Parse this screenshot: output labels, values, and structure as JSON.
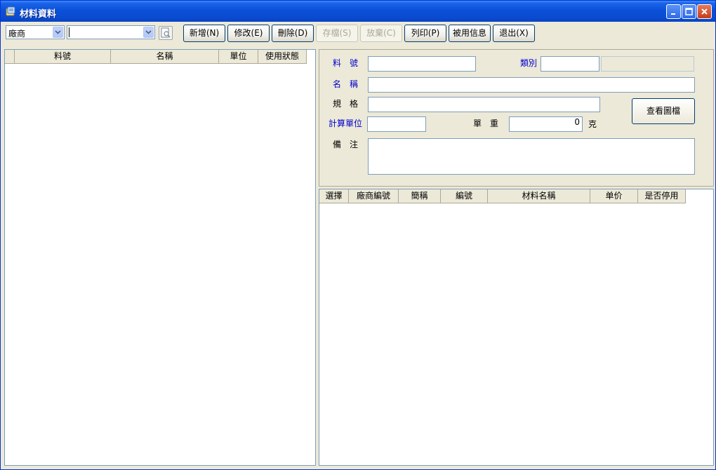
{
  "window": {
    "title": "材料資料",
    "controls": {
      "minimize": "minimize-icon",
      "maximize": "maximize-icon",
      "close": "close-icon"
    }
  },
  "toolbar": {
    "filter_field": {
      "value": "廠商"
    },
    "search_value": "",
    "buttons": {
      "new": "新增(N)",
      "edit": "修改(E)",
      "delete": "刪除(D)",
      "save": "存檔(S)",
      "cancel": "放棄(C)",
      "print": "列印(P)",
      "usage": "被用信息",
      "exit": "退出(X)"
    }
  },
  "left_grid": {
    "columns": [
      "料號",
      "名稱",
      "單位",
      "使用狀態"
    ],
    "rows": []
  },
  "form": {
    "part_no_label": "料　號",
    "part_no_value": "",
    "category_label": "類別",
    "category_value": "",
    "category_desc": "",
    "name_label": "名　稱",
    "name_value": "",
    "spec_label": "規　格",
    "spec_value": "",
    "unit_label": "計算單位",
    "unit_value": "",
    "weight_label": "單　重",
    "weight_value": "0",
    "weight_unit": "克",
    "note_label": "備　注",
    "note_value": "",
    "view_drawing_button": "查看圖檔"
  },
  "right_grid": {
    "columns": [
      "選擇",
      "廠商編號",
      "簡稱",
      "編號",
      "材料名稱",
      "单价",
      "是否停用"
    ],
    "rows": []
  },
  "colors": {
    "titlebar": "#0a4bd0",
    "window_bg": "#ece9d8",
    "label_blue": "#0000cc",
    "border": "#7f9db9"
  }
}
